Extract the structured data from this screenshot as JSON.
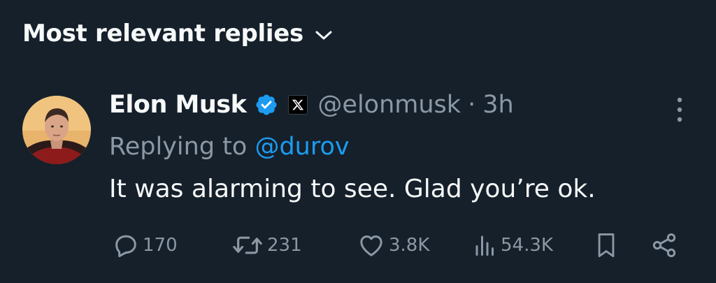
{
  "sort": {
    "label": "Most relevant replies",
    "icon": "chevron-down-icon"
  },
  "reply": {
    "author_name": "Elon Musk",
    "verified_icon": "verified-badge-icon",
    "affiliation_icon": "x-logo-icon",
    "handle": "@elonmusk",
    "separator": "·",
    "time": "3h",
    "replying_prefix": "Replying to ",
    "replying_to": "@durov",
    "text": "It was alarming to see. Glad you’re ok."
  },
  "actions": {
    "replies": "170",
    "reposts": "231",
    "likes": "3.8K",
    "views": "54.3K"
  },
  "colors": {
    "background": "#15202b",
    "primary_text": "#f7f9f9",
    "secondary_text": "#8b98a5",
    "accent": "#1d9bf0"
  }
}
